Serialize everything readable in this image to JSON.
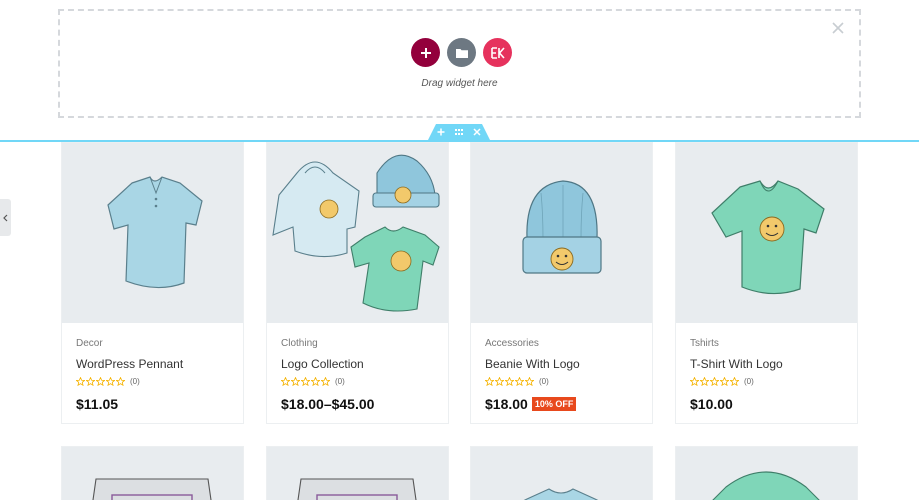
{
  "dropzone": {
    "text": "Drag widget here",
    "buttons": [
      "add-section",
      "add-template",
      "elementskit-library"
    ]
  },
  "section_handle": {
    "icons": [
      "plus-icon",
      "drag-handle-icon",
      "close-icon"
    ]
  },
  "products": [
    {
      "category": "Decor",
      "name": "WordPress Pennant",
      "rating_count": "(0)",
      "price": "$11.05",
      "badge": ""
    },
    {
      "category": "Clothing",
      "name": "Logo Collection",
      "rating_count": "(0)",
      "price": "$18.00–$45.00",
      "badge": ""
    },
    {
      "category": "Accessories",
      "name": "Beanie With Logo",
      "rating_count": "(0)",
      "price": "$18.00",
      "badge": "10% OFF"
    },
    {
      "category": "Tshirts",
      "name": "T-Shirt With Logo",
      "rating_count": "(0)",
      "price": "$10.00",
      "badge": ""
    }
  ],
  "colors": {
    "section_accent": "#71d7f7",
    "star": "#f5b301",
    "sale_badge": "#e8491d",
    "add_button": "#93003c",
    "ek_button": "#e6325d"
  }
}
